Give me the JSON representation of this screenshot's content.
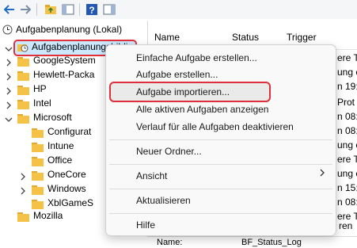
{
  "tree": {
    "root_label": "Aufgabenplanung (Lokal)",
    "library_label": "Aufgabenplanungsbiblio",
    "items": [
      {
        "label": "GoogleSystem"
      },
      {
        "label": "Hewlett-Packa"
      },
      {
        "label": "HP"
      },
      {
        "label": "Intel"
      },
      {
        "label": "Microsoft"
      },
      {
        "label": "Configurat"
      },
      {
        "label": "Intune"
      },
      {
        "label": "Office"
      },
      {
        "label": "OneCore"
      },
      {
        "label": "Windows"
      },
      {
        "label": "XblGameS"
      },
      {
        "label": "Mozilla"
      }
    ]
  },
  "list": {
    "col_name": "Name",
    "col_status": "Status",
    "col_trigger": "Trigger",
    "trigger_snippets": [
      "ere T",
      "ung e",
      "n 19:",
      "Prot",
      "n 08:",
      "n 08:",
      "ung e",
      "ere T",
      "ung e",
      "n 15:",
      "n 08:",
      "ere T",
      "ren"
    ],
    "bottom_text": "Name:",
    "bottom_text2": "BF_Status_Log"
  },
  "context_menu": {
    "items": [
      {
        "label": "Einfache Aufgabe erstellen..."
      },
      {
        "label": "Aufgabe erstellen..."
      },
      {
        "label": "Aufgabe importieren..."
      },
      {
        "label": "Alle aktiven Aufgaben anzeigen"
      },
      {
        "label": "Verlauf für alle Aufgaben deaktivieren"
      },
      {
        "label": "Neuer Ordner..."
      },
      {
        "label": "Ansicht"
      },
      {
        "label": "Aktualisieren"
      },
      {
        "label": "Hilfe"
      }
    ],
    "highlighted_index": 2,
    "has_submenu_index": 6
  },
  "colors": {
    "folder": "#f4c246",
    "highlight_border": "#e0303a",
    "selection": "#cce8ff"
  }
}
